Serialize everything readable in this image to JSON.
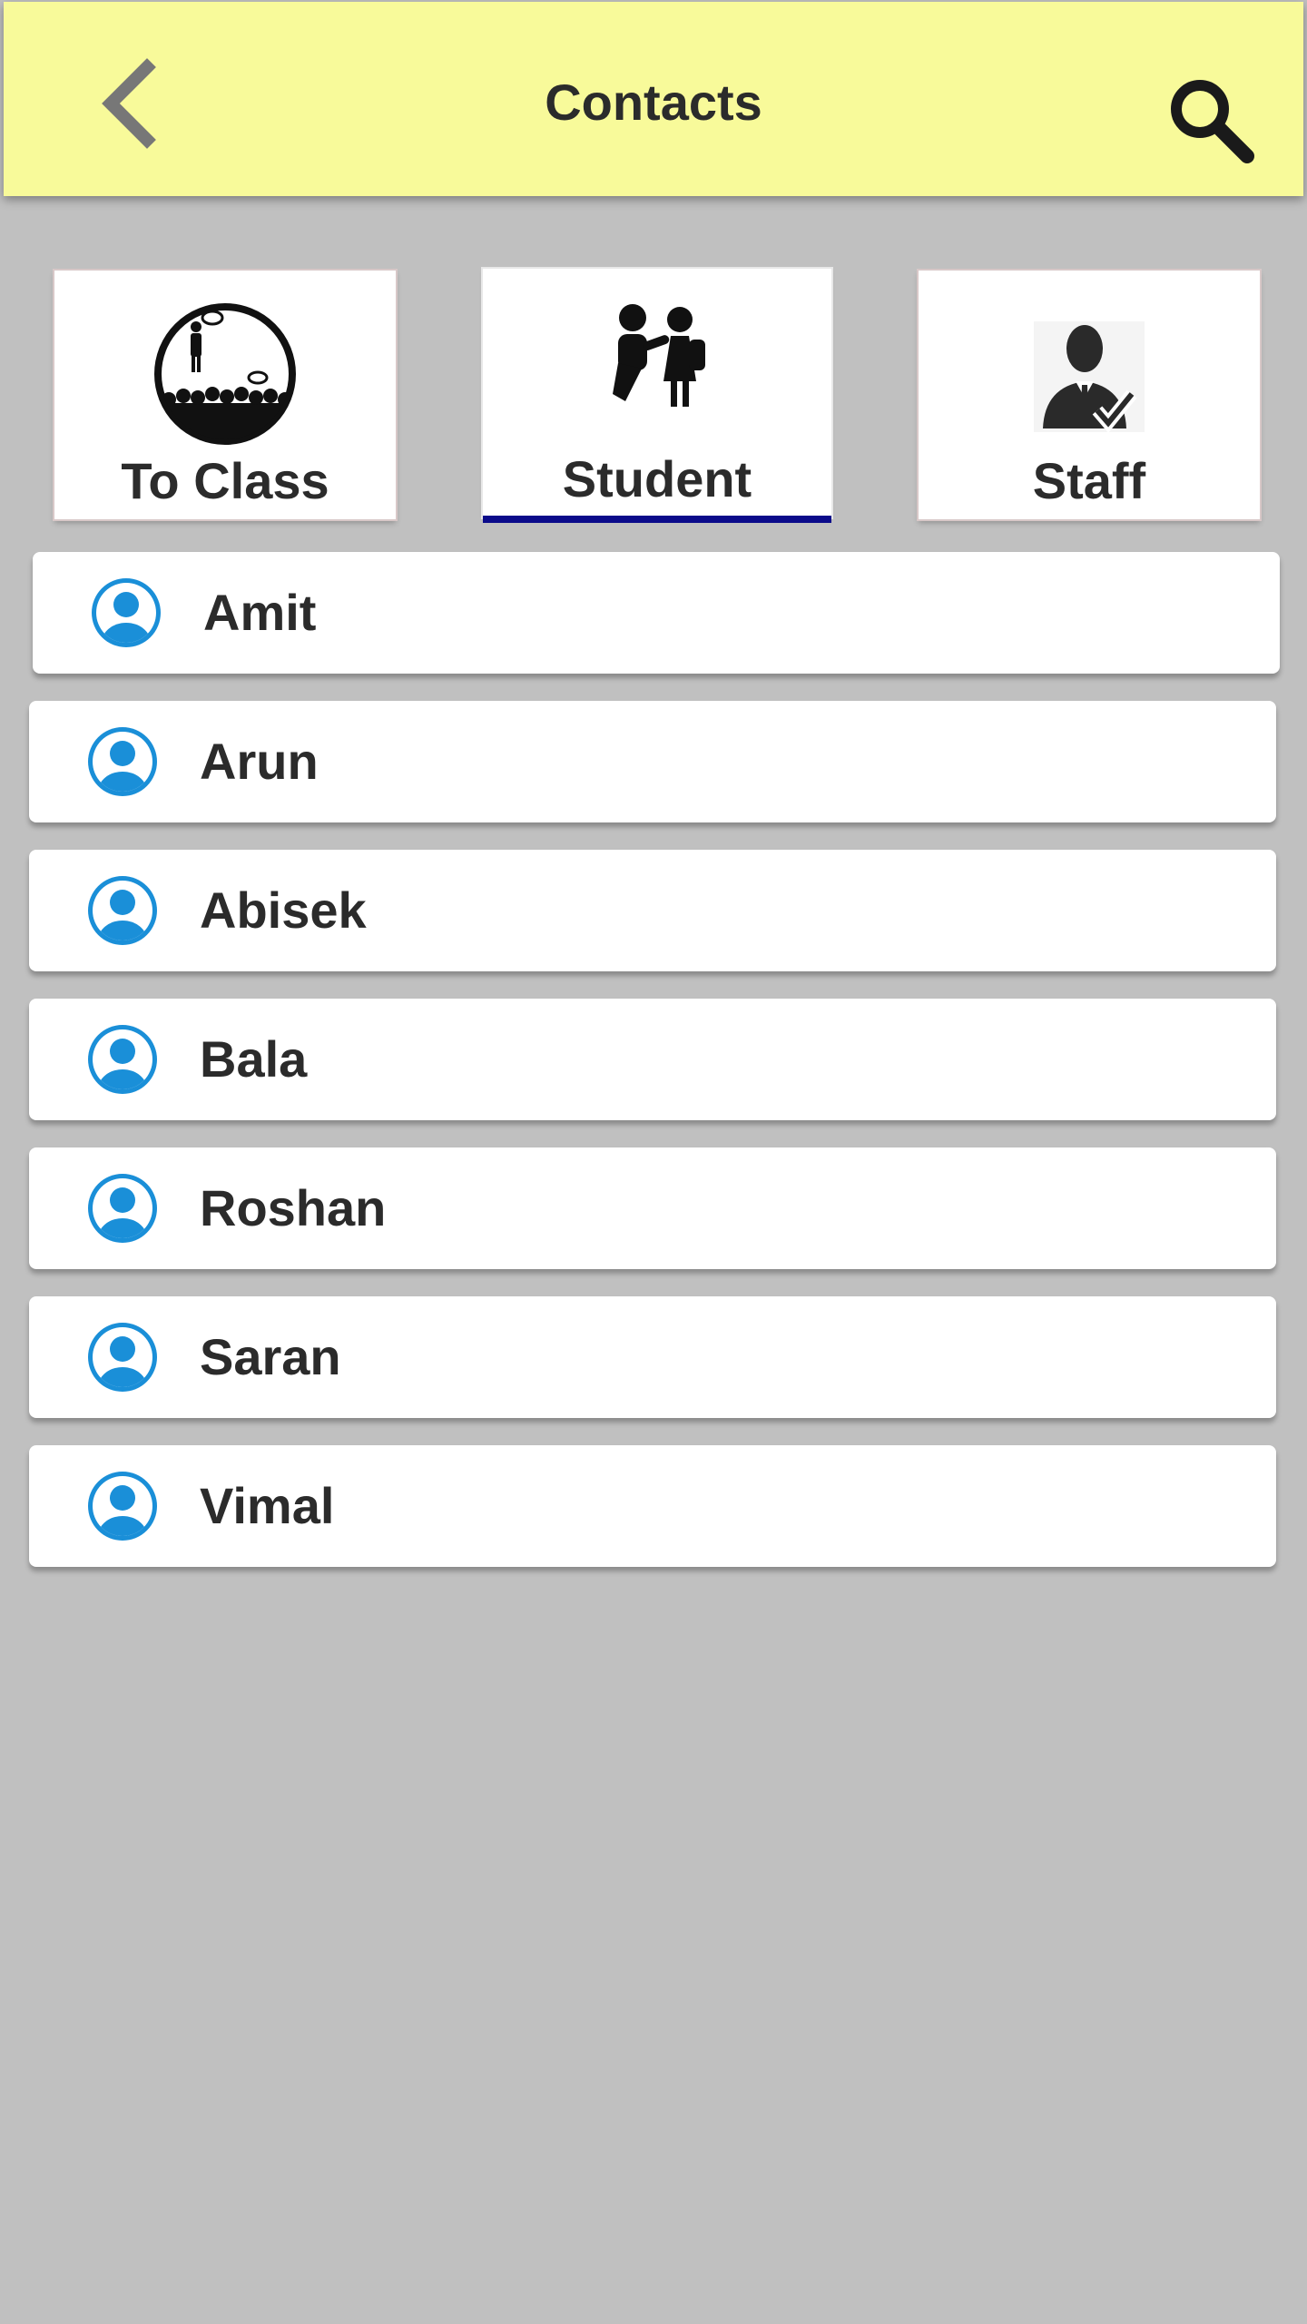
{
  "header": {
    "title": "Contacts",
    "back_icon": "chevron-left-icon",
    "search_icon": "search-icon",
    "background": "#f8fa9a"
  },
  "categories": [
    {
      "label": "To Class",
      "icon": "classroom-icon",
      "selected": false
    },
    {
      "label": "Student",
      "icon": "students-icon",
      "selected": true
    },
    {
      "label": "Staff",
      "icon": "staff-icon",
      "selected": false
    }
  ],
  "accent": {
    "tab_indicator": "#0b0b8a",
    "avatar": "#1a8fd8"
  },
  "contacts": [
    {
      "name": "Amit"
    },
    {
      "name": "Arun"
    },
    {
      "name": "Abisek"
    },
    {
      "name": "Bala"
    },
    {
      "name": "Roshan"
    },
    {
      "name": "Saran"
    },
    {
      "name": "Vimal"
    }
  ]
}
